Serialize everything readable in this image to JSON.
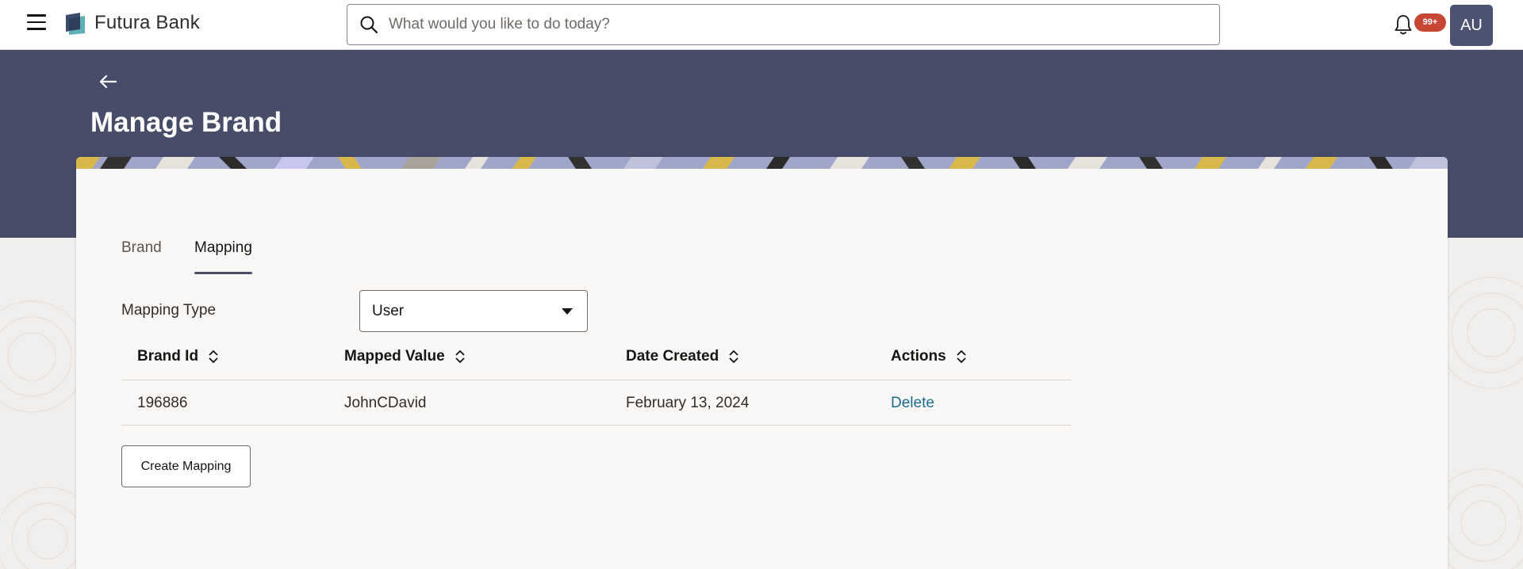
{
  "app": {
    "brand_name": "Futura Bank",
    "accent_color": "#474c69",
    "badge_color": "#c74634"
  },
  "header": {
    "menu_icon": "hamburger-icon",
    "search_placeholder": "What would you like to do today?",
    "search_value": "",
    "notification_count": "99+",
    "avatar_initials": "AU"
  },
  "page": {
    "title": "Manage Brand",
    "back_icon": "arrow-left-icon"
  },
  "tabs": [
    {
      "label": "Brand",
      "active": false
    },
    {
      "label": "Mapping",
      "active": true
    }
  ],
  "form": {
    "mapping_type_label": "Mapping Type",
    "mapping_type_value": "User"
  },
  "table": {
    "columns": [
      "Brand Id",
      "Mapped Value",
      "Date Created",
      "Actions"
    ],
    "rows": [
      {
        "brand_id": "196886",
        "mapped_value": "JohnCDavid",
        "date_created": "February 13, 2024",
        "action": "Delete"
      }
    ]
  },
  "buttons": {
    "create_mapping": "Create Mapping"
  }
}
